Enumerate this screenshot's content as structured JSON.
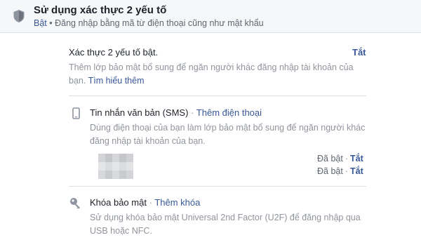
{
  "header": {
    "title": "Sử dụng xác thực 2 yếu tố",
    "status": "Bật",
    "separator": "•",
    "description": "Đăng nhập bằng mã từ điện thoại cũng như mật khẩu"
  },
  "enabled_section": {
    "title": "Xác thực 2 yếu tố bật.",
    "off_label": "Tắt",
    "description": "Thêm lớp bảo mật bổ sung để ngăn người khác đăng nhập tài khoản của bạn.",
    "learn_more": "Tìm hiểu thêm"
  },
  "sms_section": {
    "icon": "phone-icon",
    "title": "Tin nhắn văn bản (SMS)",
    "dot": "·",
    "add_phone": "Thêm điện thoại",
    "description": "Dùng điện thoại của bạn làm lớp bảo mật bổ sung để ngăn người khác đăng nhập tài khoản của bạn.",
    "phones": [
      {
        "status": "Đã bật",
        "separator": "·",
        "off": "Tắt"
      },
      {
        "status": "Đã bật",
        "separator": "·",
        "off": "Tắt"
      }
    ]
  },
  "key_section": {
    "icon": "key-icon",
    "title": "Khóa bảo mật",
    "dot": "·",
    "add_key": "Thêm khóa",
    "description": "Sử dụng khóa bảo mật Universal 2nd Factor (U2F) để đăng nhập qua USB hoặc NFC."
  },
  "colors": {
    "link": "#385898",
    "muted": "#90949c",
    "text": "#1d2129",
    "background": "#f6f7f9"
  }
}
